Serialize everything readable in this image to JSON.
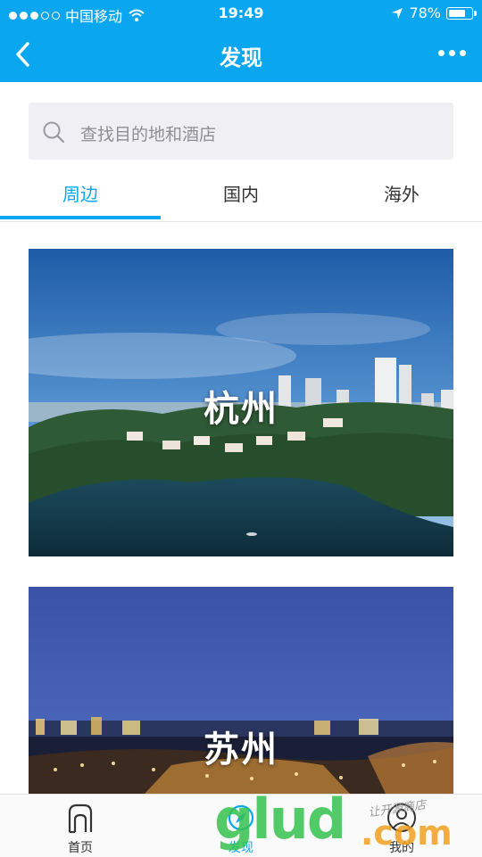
{
  "status_bar": {
    "carrier": "中国移动",
    "time": "19:49",
    "battery": "78%",
    "battery_level": 0.78
  },
  "nav": {
    "title": "发现"
  },
  "search": {
    "placeholder": "查找目的地和酒店"
  },
  "tabs": [
    {
      "label": "周边",
      "active": true
    },
    {
      "label": "国内",
      "active": false
    },
    {
      "label": "海外",
      "active": false
    }
  ],
  "cards": [
    {
      "label": "杭州"
    },
    {
      "label": "苏州"
    }
  ],
  "tab_bar": [
    {
      "label": "首页",
      "icon": "home-icon"
    },
    {
      "label": "发现",
      "icon": "discover-icon"
    },
    {
      "label": "我的",
      "icon": "profile-icon"
    }
  ],
  "watermark": {
    "main": "glud",
    "suffix": ".com",
    "tagline": "让开源商店"
  },
  "colors": {
    "accent": "#0aa7f0",
    "watermark_green": "#36c24f",
    "watermark_orange": "#f0a020"
  }
}
